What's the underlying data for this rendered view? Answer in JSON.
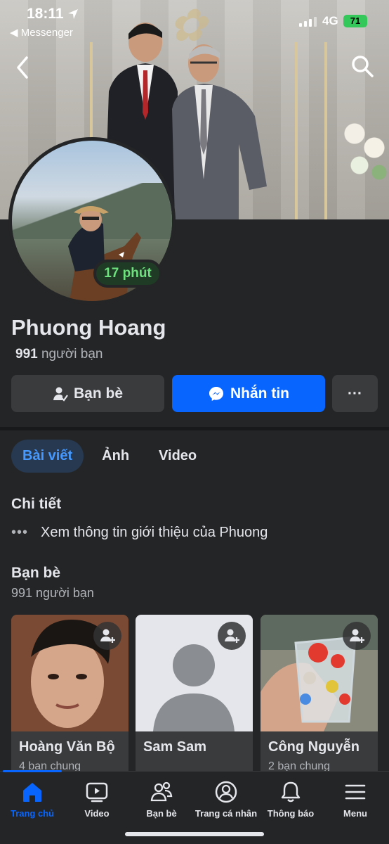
{
  "status_bar": {
    "time": "18:11",
    "back_app": "◀ Messenger",
    "network": "4G",
    "battery": "71"
  },
  "profile": {
    "name": "Phuong Hoang",
    "active_badge": "17 phút",
    "friend_count_number": "991",
    "friend_count_label": "người bạn"
  },
  "actions": {
    "friends_label": "Bạn bè",
    "message_label": "Nhắn tin",
    "more_label": "···"
  },
  "tabs": [
    {
      "label": "Bài viết",
      "active": true
    },
    {
      "label": "Ảnh",
      "active": false
    },
    {
      "label": "Video",
      "active": false
    }
  ],
  "details": {
    "title": "Chi tiết",
    "row_text": "Xem thông tin giới thiệu của Phuong"
  },
  "friends_section": {
    "title": "Bạn bè",
    "subtitle": "991 người bạn",
    "cards": [
      {
        "name": "Hoàng Văn Bộ",
        "mutual": "4 bạn chung"
      },
      {
        "name": "Sam Sam",
        "mutual": ""
      },
      {
        "name": "Công Nguyễn",
        "mutual": "2 bạn chung"
      }
    ]
  },
  "bottom_nav": [
    {
      "label": "Trang chủ",
      "icon": "home-icon",
      "active": true
    },
    {
      "label": "Video",
      "icon": "video-icon",
      "active": false
    },
    {
      "label": "Bạn bè",
      "icon": "friends-icon",
      "active": false
    },
    {
      "label": "Trang cá nhân",
      "icon": "profile-icon",
      "active": false
    },
    {
      "label": "Thông báo",
      "icon": "bell-icon",
      "active": false
    },
    {
      "label": "Menu",
      "icon": "menu-icon",
      "active": false
    }
  ],
  "colors": {
    "accent": "#0866ff",
    "background": "#242526",
    "active_badge_text": "#6ee07e"
  }
}
